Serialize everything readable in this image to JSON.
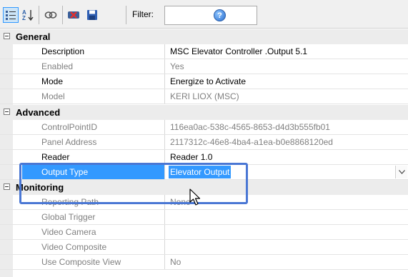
{
  "toolbar": {
    "filter_label": "Filter:",
    "filter_value": "",
    "help_label": "?",
    "buttons": [
      {
        "icon": "categorized-view-icon",
        "active": true
      },
      {
        "icon": "sort-alphabetical-icon",
        "active": false
      },
      {
        "icon": "link-icon",
        "active": false
      },
      {
        "icon": "delete-icon",
        "active": false
      },
      {
        "icon": "save-icon",
        "active": false
      }
    ]
  },
  "grid": {
    "categories": [
      {
        "label": "General"
      },
      {
        "label": "Advanced"
      },
      {
        "label": "Monitoring"
      }
    ],
    "general": [
      {
        "name": "Description",
        "value": "MSC Elevator Controller .Output 5.1"
      },
      {
        "name": "Enabled",
        "value": "Yes"
      },
      {
        "name": "Mode",
        "value": "Energize to Activate"
      },
      {
        "name": "Model",
        "value": "KERI LIOX (MSC)"
      }
    ],
    "advanced": [
      {
        "name": "ControlPointID",
        "value": "116ea0ac-538c-4565-8653-d4d3b555fb01"
      },
      {
        "name": "Panel Address",
        "value": "2117312c-46e8-4ba4-a1ea-b0e8868120ed"
      },
      {
        "name": "Reader",
        "value": "Reader 1.0"
      },
      {
        "name": "Output Type",
        "value": "Elevator Output"
      }
    ],
    "monitoring": [
      {
        "name": "Reporting Path",
        "value": "None"
      },
      {
        "name": "Global Trigger",
        "value": ""
      },
      {
        "name": "Video Camera",
        "value": ""
      },
      {
        "name": "Video Composite",
        "value": ""
      },
      {
        "name": "Use Composite View",
        "value": "No"
      }
    ]
  },
  "colors": {
    "selection": "#3399ff",
    "highlight_border": "#4a77d4",
    "category_bg": "#ececec"
  }
}
